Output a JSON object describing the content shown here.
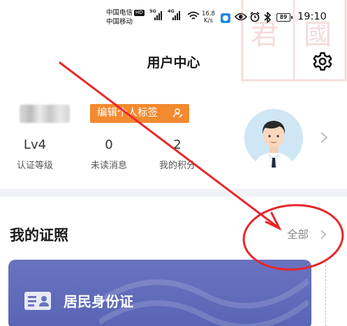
{
  "status_bar": {
    "carrier_1": "中国电信",
    "hd_badge": "HD",
    "carrier_2": "中国移动",
    "signal_1": "5G",
    "signal_2": "4G",
    "net_speed_value": "16.8",
    "net_speed_unit": "K/s",
    "battery": "89",
    "time": "19:10"
  },
  "watermark": {
    "chars": [
      "國",
      "君"
    ]
  },
  "header": {
    "title": "用户中心",
    "settings_icon": "gear-icon"
  },
  "profile": {
    "edit_tag_label": "编辑个人标签",
    "stats": [
      {
        "value": "Lv4",
        "label": "认证等级"
      },
      {
        "value": "0",
        "label": "未读消息"
      },
      {
        "value": "2",
        "label": "我的积分"
      }
    ],
    "avatar_icon": "avatar-cartoon-man"
  },
  "licenses": {
    "title": "我的证照",
    "all_label": "全部",
    "card_title": "居民身份证",
    "card_icon": "id-card-icon"
  },
  "annotation": {
    "color": "#e8262a"
  }
}
